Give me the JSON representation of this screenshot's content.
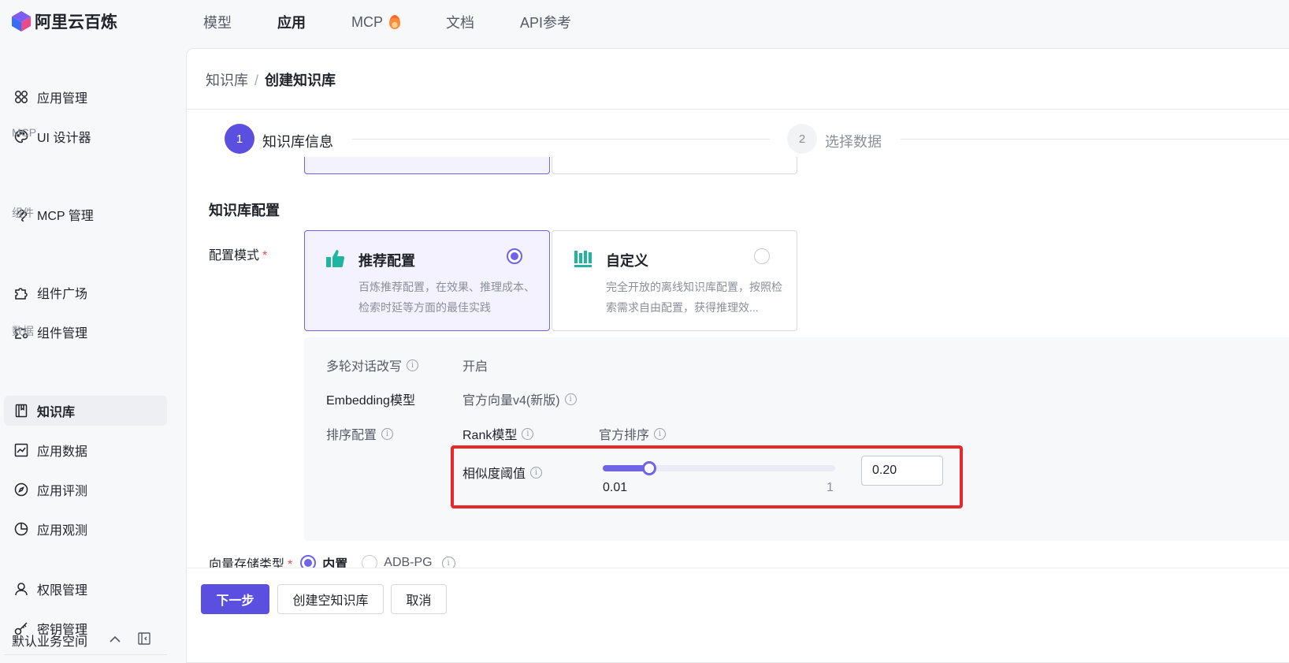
{
  "brand": {
    "name": "阿里云百炼"
  },
  "topnav": [
    {
      "label": "模型",
      "active": false
    },
    {
      "label": "应用",
      "active": true
    },
    {
      "label": "MCP",
      "active": false,
      "icon": "fire-icon"
    },
    {
      "label": "文档",
      "active": false
    },
    {
      "label": "API参考",
      "active": false
    }
  ],
  "sidebar": {
    "items": [
      {
        "label": "应用管理",
        "icon": "apps-icon"
      },
      {
        "label": "UI 设计器",
        "icon": "palette-icon"
      },
      {
        "label": "MCP 管理",
        "icon": "mcp-icon"
      },
      {
        "label": "组件广场",
        "icon": "puzzle-icon"
      },
      {
        "label": "组件管理",
        "icon": "puzzle-gear-icon"
      },
      {
        "label": "知识库",
        "icon": "book-icon",
        "active": true
      },
      {
        "label": "应用数据",
        "icon": "chart-icon"
      },
      {
        "label": "应用评测",
        "icon": "compass-icon"
      },
      {
        "label": "应用观测",
        "icon": "pie-icon"
      },
      {
        "label": "权限管理",
        "icon": "user-icon"
      },
      {
        "label": "密钥管理",
        "icon": "key-icon"
      }
    ],
    "groups": {
      "mcp": "MCP",
      "components": "组件",
      "data": "数据"
    },
    "workspace": "默认业务空间"
  },
  "breadcrumb": {
    "root": "知识库",
    "separator": "/",
    "current": "创建知识库"
  },
  "steps": [
    {
      "number": "1",
      "label": "知识库信息",
      "active": true
    },
    {
      "number": "2",
      "label": "选择数据",
      "active": false
    }
  ],
  "section": {
    "title": "知识库配置"
  },
  "config_mode": {
    "label": "配置模式",
    "required_mark": "*",
    "options": [
      {
        "title": "推荐配置",
        "desc": "百炼推荐配置，在效果、推理成本、检索时延等方面的最佳实践",
        "selected": true,
        "icon": "thumbs-up-icon"
      },
      {
        "title": "自定义",
        "desc": "完全开放的离线知识库配置，按照检索需求自由配置，获得推理效...",
        "selected": false,
        "icon": "library-icon"
      }
    ]
  },
  "details": {
    "multi_turn": {
      "label": "多轮对话改写",
      "value": "开启"
    },
    "embedding": {
      "label": "Embedding模型",
      "value": "官方向量v4(新版)"
    },
    "rank": {
      "label": "排序配置",
      "model_label": "Rank模型",
      "model_value": "官方排序"
    },
    "similarity": {
      "label": "相似度阈值",
      "min": "0.01",
      "max": "1",
      "value": "0.20",
      "level": 0.2
    }
  },
  "vector_store": {
    "label": "向量存储类型",
    "required_mark": "*",
    "options": [
      {
        "label": "内置",
        "selected": true
      },
      {
        "label": "ADB-PG",
        "selected": false
      }
    ]
  },
  "buttons": {
    "next": "下一步",
    "create_empty": "创建空知识库",
    "cancel": "取消"
  },
  "colors": {
    "accent": "#5b4fe0",
    "highlight": "#e8292b",
    "teal": "#1fb5a0"
  }
}
